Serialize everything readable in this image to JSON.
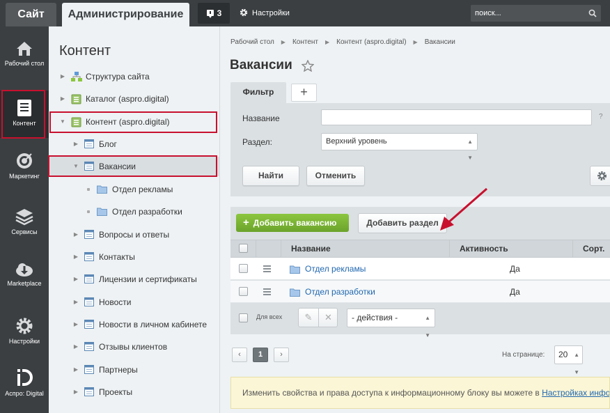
{
  "topbar": {
    "site_tab": "Сайт",
    "admin_tab": "Администрирование",
    "notifications_count": "3",
    "settings_label": "Настройки",
    "search_placeholder": "поиск..."
  },
  "iconbar": [
    {
      "label": "Рабочий стол",
      "icon": "home-icon"
    },
    {
      "label": "Контент",
      "icon": "document-icon",
      "active": true
    },
    {
      "label": "Маркетинг",
      "icon": "target-icon"
    },
    {
      "label": "Сервисы",
      "icon": "layers-icon"
    },
    {
      "label": "Marketplace",
      "icon": "cloud-download-icon"
    },
    {
      "label": "Настройки",
      "icon": "gear-icon"
    },
    {
      "label": "Аспро: Digital",
      "icon": "aspro-logo-icon"
    }
  ],
  "tree": {
    "title": "Контент",
    "items": [
      {
        "label": "Структура сайта",
        "level": 0,
        "icon": "sitemap-icon"
      },
      {
        "label": "Каталог (aspro.digital)",
        "level": 0,
        "icon": "iblock-type-icon"
      },
      {
        "label": "Контент (aspro.digital)",
        "level": 0,
        "icon": "iblock-type-icon",
        "expanded": true
      },
      {
        "label": "Блог",
        "level": 1,
        "icon": "iblock-icon"
      },
      {
        "label": "Вакансии",
        "level": 1,
        "icon": "iblock-icon",
        "expanded": true,
        "selected": true
      },
      {
        "label": "Отдел рекламы",
        "level": 2,
        "icon": "folder-icon"
      },
      {
        "label": "Отдел разработки",
        "level": 2,
        "icon": "folder-icon"
      },
      {
        "label": "Вопросы и ответы",
        "level": 1,
        "icon": "iblock-icon"
      },
      {
        "label": "Контакты",
        "level": 1,
        "icon": "iblock-icon"
      },
      {
        "label": "Лицензии и сертификаты",
        "level": 1,
        "icon": "iblock-icon"
      },
      {
        "label": "Новости",
        "level": 1,
        "icon": "iblock-icon"
      },
      {
        "label": "Новости в личном кабинете",
        "level": 1,
        "icon": "iblock-icon"
      },
      {
        "label": "Отзывы клиентов",
        "level": 1,
        "icon": "iblock-icon"
      },
      {
        "label": "Партнеры",
        "level": 1,
        "icon": "iblock-icon"
      },
      {
        "label": "Проекты",
        "level": 1,
        "icon": "iblock-icon"
      }
    ]
  },
  "breadcrumb": [
    "Рабочий стол",
    "Контент",
    "Контент (aspro.digital)",
    "Вакансии"
  ],
  "page_title": "Вакансии",
  "filter": {
    "tab_label": "Фильтр",
    "add_tab": "+",
    "name_label": "Название",
    "name_value": "",
    "help": "?",
    "section_label": "Раздел:",
    "section_value": "Верхний уровень",
    "find_button": "Найти",
    "cancel_button": "Отменить"
  },
  "list": {
    "add_vacancy_button": "Добавить вакансию",
    "add_section_button": "Добавить раздел",
    "columns": {
      "name": "Название",
      "active": "Активность",
      "sort": "Сорт."
    },
    "rows": [
      {
        "name": "Отдел рекламы",
        "active": "Да"
      },
      {
        "name": "Отдел разработки",
        "active": "Да"
      }
    ],
    "for_all_label": "Для всех",
    "actions_value": "- действия -"
  },
  "pagination": {
    "prev": "‹",
    "current": "1",
    "next": "›",
    "per_page_label": "На странице:",
    "per_page_value": "20"
  },
  "notice": {
    "text": "Изменить свойства и права доступа к информационному блоку вы можете в ",
    "link": "Настройках инфор"
  },
  "colors": {
    "dark_bar": "#3b3f42",
    "accent_green": "#7ab833",
    "highlight_red": "#c8102e",
    "link_blue": "#2067b0"
  }
}
